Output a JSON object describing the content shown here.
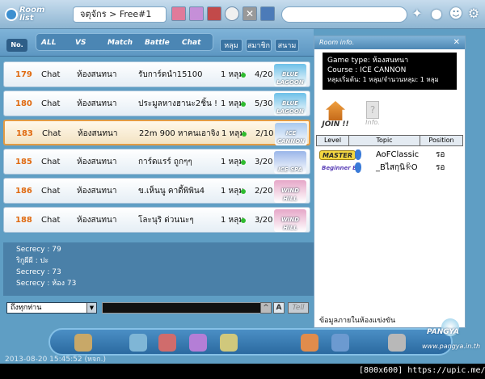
{
  "header": {
    "logo_text": "Room list",
    "breadcrumb": "จตุจักร > Free#1",
    "search_value": ""
  },
  "filters": {
    "no_label": "No.",
    "tabs": [
      "ALL",
      "VS",
      "Match",
      "Battle",
      "Chat"
    ],
    "sort_buttons": [
      "หลุม",
      "สมาชิก",
      "สนาม"
    ]
  },
  "rooms": [
    {
      "num": "179",
      "type": "Chat",
      "mode": "ห้องสนทนา",
      "title": "รับการ์ดนำ15100",
      "holes": "1 หลุม",
      "count": "4/20",
      "course": "BLUE LAGOON",
      "course_color": "#6cc0e8",
      "selected": false
    },
    {
      "num": "180",
      "type": "Chat",
      "mode": "ห้องสนทนา",
      "title": "ประมูลหางฮานะ2ชิ้น !",
      "holes": "1 หลุม",
      "count": "5/30",
      "course": "BLUE LAGOON",
      "course_color": "#6cc0e8",
      "selected": false
    },
    {
      "num": "183",
      "type": "Chat",
      "mode": "ห้องสนทนา",
      "title": "22m 900 หาคนเอาจิง",
      "holes": "1 หลุม",
      "count": "2/10",
      "course": "ICE CANNON",
      "course_color": "#a9c9ef",
      "selected": true
    },
    {
      "num": "185",
      "type": "Chat",
      "mode": "ห้องสนทนา",
      "title": "การ์ดแรร์ ถูกๆๆ",
      "holes": "1 หลุม",
      "count": "3/20",
      "course": "ICE SPA",
      "course_color": "#9ab6e9",
      "selected": false
    },
    {
      "num": "186",
      "type": "Chat",
      "mode": "ห้องสนทนา",
      "title": "ข.เห็นนู คาดี้พิพิน4",
      "holes": "1 หลุม",
      "count": "2/20",
      "course": "WIND HILL",
      "course_color": "#e6a7c8",
      "selected": false
    },
    {
      "num": "188",
      "type": "Chat",
      "mode": "ห้องสนทนา",
      "title": "โละนุริ ด่วนนะๆ",
      "holes": "1 หลุม",
      "count": "3/20",
      "course": "WIND HILL",
      "course_color": "#e6a7c8",
      "selected": false
    }
  ],
  "chat_lines": [
    "Secrecy : 79",
    "ริกูผีผี : ปะ",
    "Secrecy : 73",
    "Secrecy : ห้อง 73"
  ],
  "chat_input": {
    "target": "ถึงทุกท่าน",
    "value": "",
    "font_label": "A",
    "send_label": "Tell"
  },
  "room_info": {
    "header": "Room info.",
    "game_type": "Game type: ห้องสนทนา",
    "course": "Course : ICE CANNON",
    "holes": "หลุมเริ่มต้น: 1 หลุม/จำนวนหลุม: 1 หลุม",
    "join_label": "JOIN !!",
    "info_label": "Info.",
    "columns": [
      "Level",
      "Topic",
      "Position"
    ],
    "players": [
      {
        "level": "MASTER",
        "level_color": "#f3d640",
        "name": "AoFClassic",
        "position": "รอ"
      },
      {
        "level": "Beginner B",
        "level_color": "#ffffff",
        "name": "_BไสกุนิꆜO",
        "position": "รอ"
      }
    ],
    "footer": "ข้อมูลภายในห้องแข่งขัน"
  },
  "footer": {
    "timestamp": "2013-08-20 15:45:52 (หจก.)",
    "brand": "PANGYA",
    "url": "www.pangya.in.th"
  },
  "watermark": "[800x600] https://upic.me/"
}
